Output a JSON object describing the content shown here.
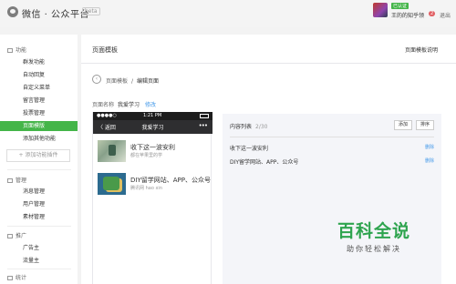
{
  "topbar": {
    "logo_text": "微信 · 公众平台",
    "beta": "beta",
    "account": {
      "tag": "已认证",
      "name": "王的的知乎领",
      "badge": "2",
      "exit": "退出"
    }
  },
  "sidebar": {
    "groups": [
      {
        "label": "功能",
        "icon": "function-icon"
      },
      {
        "label": "管理",
        "icon": "manage-icon"
      },
      {
        "label": "推广",
        "icon": "promotion-icon"
      },
      {
        "label": "统计",
        "icon": "stats-icon"
      }
    ],
    "items_func": [
      "群发功能",
      "自动回复",
      "自定义菜单",
      "留言管理",
      "投票管理",
      "页面模版",
      "添加其他功能"
    ],
    "add_plugin": "+ 添加功能插件",
    "items_manage": [
      "消息管理",
      "用户管理",
      "素材管理"
    ],
    "items_promo": [
      "广告主",
      "流量主"
    ],
    "active_index": 5
  },
  "main": {
    "title": "页面模板",
    "help": "页面模板说明",
    "breadcrumb": {
      "parent": "页面模板",
      "current": "编辑页面"
    },
    "name_label": "页面名称",
    "name_value": "我爱学习",
    "name_edit": "修改"
  },
  "phone": {
    "carrier": "●●●●○",
    "time": "1:21 PM",
    "back": "〈 返回",
    "title": "我爱学习",
    "more": "•••",
    "articles": [
      {
        "title": "收下这一波安利",
        "sub": "都在苹果里的学",
        "thumb": "thumb-study"
      },
      {
        "title": "DIY留学网站、APP、公众号",
        "sub": "腾讯网 hao xin",
        "thumb": "thumb-diy"
      }
    ]
  },
  "content_list": {
    "title": "内容列表",
    "count": "2/30",
    "add": "添加",
    "sort": "排序",
    "rows": [
      {
        "title": "收下这一波安利",
        "action": "删除"
      },
      {
        "title": "DIY留学网站、APP、公众号",
        "action": "删除"
      }
    ]
  },
  "watermark": {
    "title": "百科全说",
    "sub": "助你轻松解决"
  },
  "colors": {
    "accent": "#44b549",
    "link": "#459ae9",
    "dark_nav": "#2e2e30",
    "watermark": "#2ea44f"
  }
}
